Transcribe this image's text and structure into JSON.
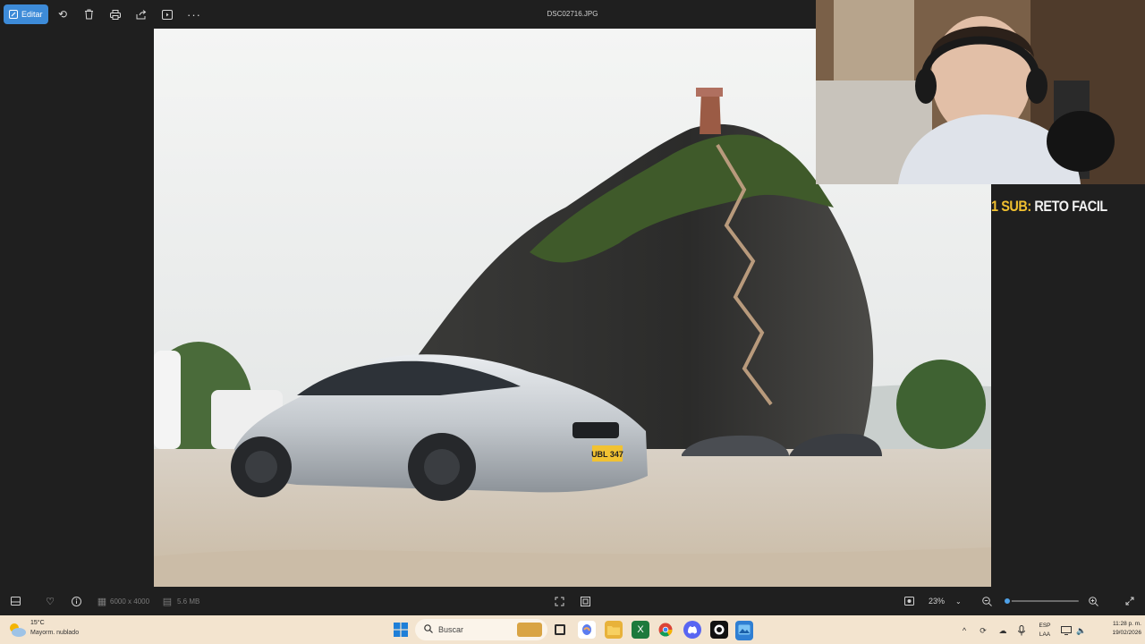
{
  "toolbar": {
    "edit_label": "Editar",
    "icons": [
      "rotate-icon",
      "delete-icon",
      "print-icon",
      "share-icon",
      "slideshow-icon",
      "more-icon"
    ]
  },
  "file": {
    "name": "DSC02716.JPG"
  },
  "overlay": {
    "sub_prefix": "1 SUB:",
    "sub_text": "RETO FACIL"
  },
  "photo": {
    "plate": "UBL 347"
  },
  "viewer": {
    "dimensions": "6000 x 4000",
    "size": "5.6 MB",
    "zoom": "23%",
    "zoom_fraction": 0.03
  },
  "taskbar": {
    "weather_temp": "15°C",
    "weather_desc": "Mayorm. nublado",
    "search_placeholder": "Buscar",
    "lang_top": "ESP",
    "lang_bottom": "LAA",
    "time": "11:28 p. m.",
    "date": "19/02/2026"
  },
  "colors": {
    "accent": "#3d8bd8",
    "taskbar": "#f3e4cf",
    "toolbar": "#1f1f1f"
  }
}
